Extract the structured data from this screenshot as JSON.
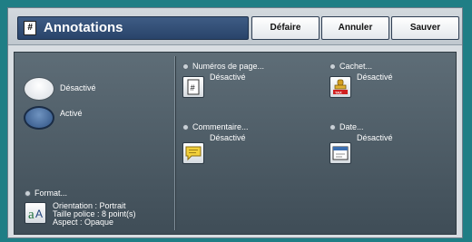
{
  "header": {
    "title": "Annotations",
    "buttons": {
      "undo": "Défaire",
      "cancel": "Annuler",
      "save": "Sauver"
    }
  },
  "mode": {
    "off_label": "Désactivé",
    "on_label": "Activé",
    "selected": "on"
  },
  "format": {
    "label": "Format...",
    "orientation": "Orientation : Portrait",
    "font_size": "Taille police : 8 point(s)",
    "aspect": "Aspect : Opaque"
  },
  "features": {
    "page_numbers": {
      "label": "Numéros de page...",
      "value": "Désactivé"
    },
    "stamp": {
      "label": "Cachet...",
      "value": "Désactivé"
    },
    "comment": {
      "label": "Commentaire...",
      "value": "Désactivé"
    },
    "date": {
      "label": "Date...",
      "value": "Désactivé"
    }
  },
  "icons": {
    "title": "page-number-icon",
    "page_numbers": "page-number-icon",
    "stamp": "stamp-icon",
    "comment": "comment-bubble-icon",
    "date": "calendar-window-icon",
    "format": "font-format-icon"
  },
  "colors": {
    "background": "#1f7e85",
    "panel": "#4e5c66",
    "title_bar": "#34507a"
  }
}
